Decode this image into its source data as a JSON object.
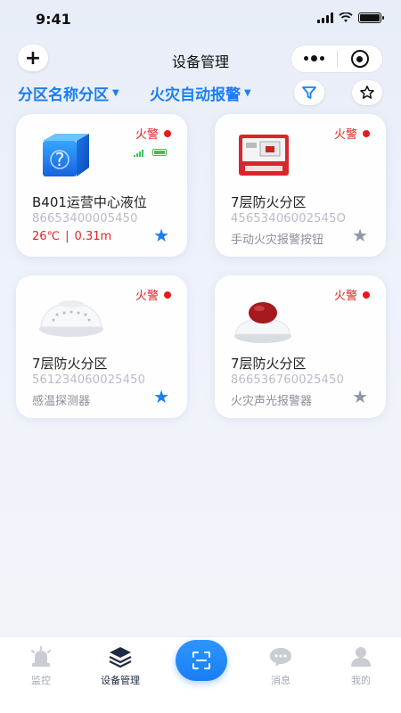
{
  "status": {
    "time": "9:41"
  },
  "nav": {
    "title": "设备管理",
    "add_symbol": "+"
  },
  "filters": {
    "zone": "分区名称分区",
    "type": "火灾自动报警"
  },
  "icons": {
    "filter": "filter-icon",
    "favorites": "star-outline-icon",
    "more": "more-dots-icon",
    "close": "target-icon",
    "scan": "scan-icon"
  },
  "colors": {
    "accent": "#1a7ef2",
    "alarm": "#e02525",
    "star_inactive": "#8f97a8"
  },
  "devices": [
    {
      "alarm": "火警",
      "name": "B401运营中心液位",
      "code": "86653400005450",
      "temp": "26℃",
      "sep": "|",
      "level": "0.31m",
      "starred": true,
      "star": "★"
    },
    {
      "alarm": "火警",
      "name": "7层防火分区",
      "code": "45653406002545O",
      "type": "手动火灾报警按钮",
      "starred": false,
      "star": "★"
    },
    {
      "alarm": "火警",
      "name": "7层防火分区",
      "code": "561234060025450",
      "type": "感温探测器",
      "starred": true,
      "star": "★"
    },
    {
      "alarm": "火警",
      "name": "7层防火分区",
      "code": "866536760025450",
      "type": "火灾声光报警器",
      "starred": false,
      "star": "★"
    }
  ],
  "tabs": [
    {
      "label": "监控",
      "icon": "alarm-light-icon"
    },
    {
      "label": "设备管理",
      "icon": "layers-icon",
      "active": true
    },
    {
      "label": "消息",
      "icon": "chat-bubble-icon"
    },
    {
      "label": "我的",
      "icon": "user-icon"
    }
  ]
}
